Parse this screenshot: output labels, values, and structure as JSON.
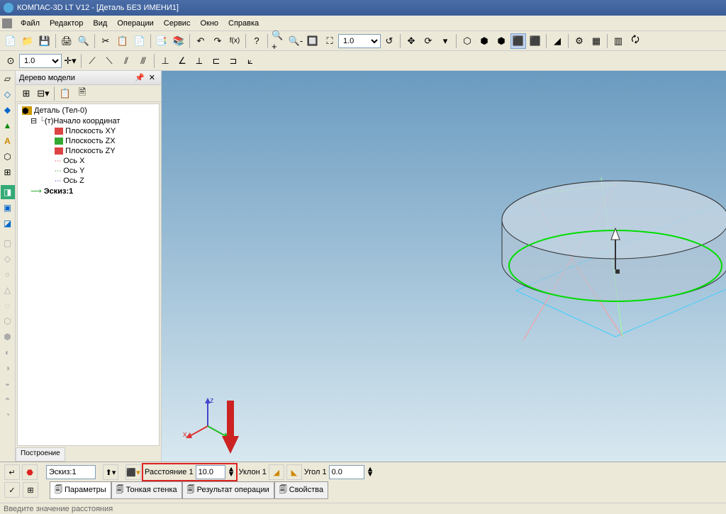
{
  "title_bar": "КОМПАС-3D LT V12 - [Деталь БЕЗ ИМЕНИ1]",
  "menu": {
    "file": "Файл",
    "editor": "Редактор",
    "view": "Вид",
    "operations": "Операции",
    "service": "Сервис",
    "window": "Окно",
    "help": "Справка"
  },
  "toolbar1": {
    "scale": "1.0"
  },
  "toolbar2": {
    "step": "1.0"
  },
  "tree": {
    "title": "Дерево модели",
    "root": "Деталь (Тел-0)",
    "origin": "(т)Начало координат",
    "plane_xy": "Плоскость XY",
    "plane_zx": "Плоскость ZX",
    "plane_zy": "Плоскость ZY",
    "axis_x": "Ось X",
    "axis_y": "Ось Y",
    "axis_z": "Ось Z",
    "sketch": "Эскиз:1",
    "tab": "Построение"
  },
  "axis_labels": {
    "x": "x",
    "y": "y",
    "z": "z"
  },
  "prop": {
    "sketch_label": "Эскиз:1",
    "dist_label": "Расстояние 1",
    "dist_value": "10.0",
    "slope_label": "Уклон 1",
    "angle_label": "Угол 1",
    "angle_value": "0.0",
    "tab_params": "Параметры",
    "tab_thin": "Тонкая стенка",
    "tab_result": "Результат операции",
    "tab_props": "Свойства"
  },
  "status": "Введите значение расстояния"
}
